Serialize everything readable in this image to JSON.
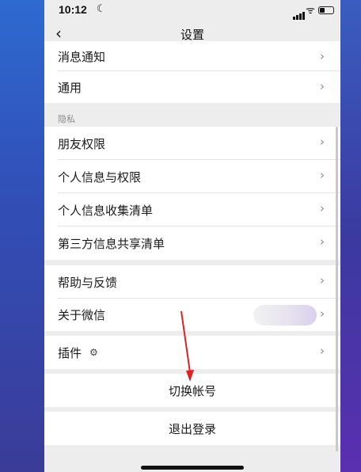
{
  "status_bar": {
    "time": "10:12",
    "moon": "☾",
    "wifi": "ᯤ"
  },
  "nav": {
    "back": "‹",
    "title": "设置"
  },
  "groups": {
    "top_rows": [
      "消息通知",
      "通用"
    ],
    "privacy_header": "隐私",
    "privacy_rows": [
      "朋友权限",
      "个人信息与权限",
      "个人信息收集清单",
      "第三方信息共享清单"
    ],
    "help_rows": [
      "帮助与反馈",
      "关于微信"
    ],
    "plugin_row": "插件"
  },
  "actions": {
    "switch_account": "切换帐号",
    "logout": "退出登录"
  },
  "chevron": "›",
  "plugin_icon_glyph": "⚙",
  "colors": {
    "annotation_arrow": "#e02020"
  }
}
